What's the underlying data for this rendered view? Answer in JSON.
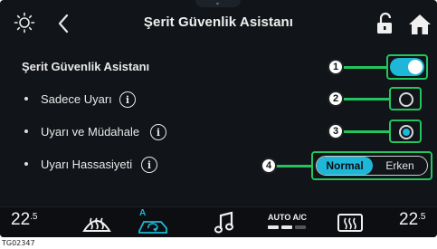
{
  "header": {
    "title": "Şerit Güvenlik Asistanı",
    "icons": [
      "brightness-icon",
      "back-chevron-icon",
      "unlock-icon",
      "home-icon"
    ]
  },
  "settings": {
    "main_label": "Şerit Güvenlik Asistanı",
    "main_enabled": true,
    "option_warn_only_label": "Sadece Uyarı",
    "option_warn_intervene_label": "Uyarı ve Müdahale",
    "selected_option": "Uyarı ve Müdahale",
    "sensitivity_label": "Uyarı Hassasiyeti",
    "sensitivity_options": [
      "Normal",
      "Erken"
    ],
    "sensitivity_selected": "Normal",
    "info_glyph": "i"
  },
  "callouts": [
    "1",
    "2",
    "3",
    "4"
  ],
  "bottom_bar": {
    "temp_left_main": "22",
    "temp_left_decimal": ".5",
    "temp_right_main": "22",
    "temp_right_decimal": ".5",
    "auto_ac_label": "AUTO A/C",
    "recirc_badge": "A",
    "icons": [
      "front-defrost-icon",
      "air-recirculation-icon",
      "music-note-icon",
      "rear-defrost-icon"
    ]
  },
  "figure_code": "TG02347",
  "colors": {
    "accent": "#1fb7d8",
    "callout_green": "#22c55e",
    "background": "#111418"
  }
}
